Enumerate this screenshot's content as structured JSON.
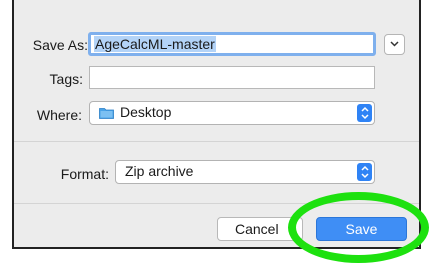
{
  "dialog": {
    "save_as_label": "Save As:",
    "save_as_value": "AgeCalcML-master",
    "tags_label": "Tags:",
    "tags_value": "",
    "where_label": "Where:",
    "where_value": "Desktop",
    "format_label": "Format:",
    "format_value": "Zip archive",
    "cancel_label": "Cancel",
    "save_label": "Save"
  },
  "icons": {
    "expand": "chevron-down-icon",
    "folder": "folder-icon",
    "popup_arrows": "up-down-arrows-icon"
  },
  "colors": {
    "accent": "#3f8ef5",
    "selection": "#b3d3f7",
    "highlight_ring": "#1de10f",
    "folder": "#4aa3e8"
  }
}
